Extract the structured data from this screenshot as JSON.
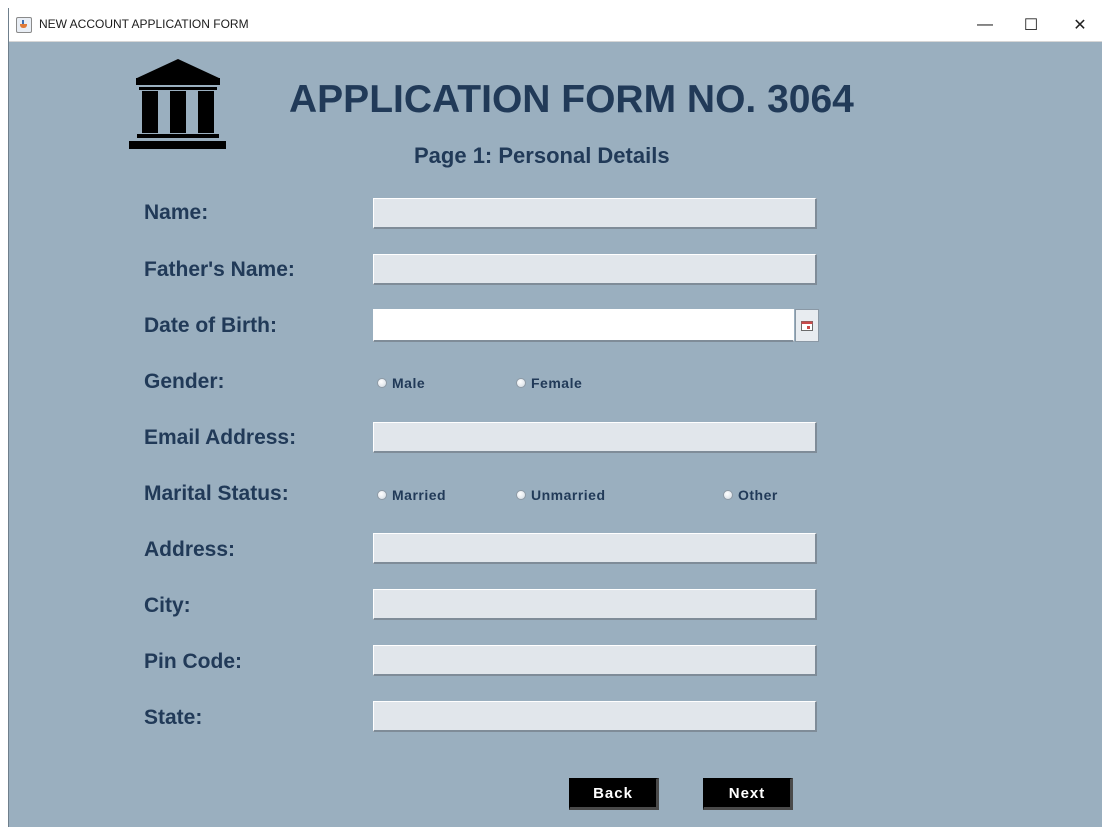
{
  "window": {
    "title": "NEW ACCOUNT APPLICATION FORM",
    "controls": {
      "minimize": "—",
      "maximize": "☐",
      "close": "✕"
    }
  },
  "header": {
    "logo_icon": "bank-building-icon",
    "title": "APPLICATION FORM NO. 3064",
    "subtitle": "Page 1: Personal Details"
  },
  "labels": {
    "name": "Name:",
    "fathers_name": "Father's Name:",
    "dob": "Date of Birth:",
    "gender": "Gender:",
    "email": "Email Address:",
    "marital": "Marital Status:",
    "address": "Address:",
    "city": "City:",
    "pin": "Pin Code:",
    "state": "State:"
  },
  "values": {
    "name": "",
    "fathers_name": "",
    "dob": "",
    "email": "",
    "address": "",
    "city": "",
    "pin": "",
    "state": ""
  },
  "gender_options": [
    "Male",
    "Female"
  ],
  "marital_options": [
    "Married",
    "Unmarried",
    "Other"
  ],
  "buttons": {
    "back": "Back",
    "next": "Next"
  },
  "colors": {
    "background": "#9aafbf",
    "text": "#213a58",
    "field": "#e1e6eb",
    "button": "#000000"
  }
}
